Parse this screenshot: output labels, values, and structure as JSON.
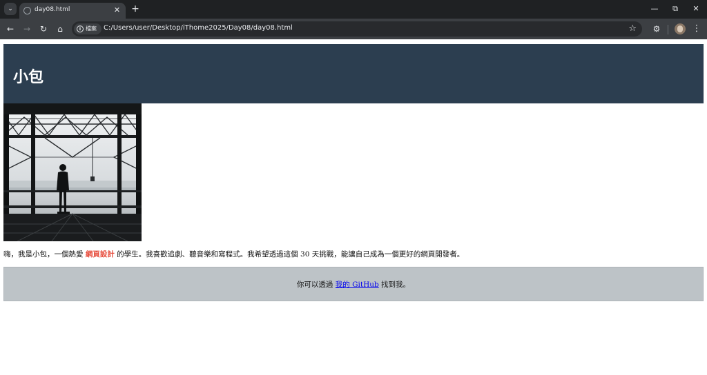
{
  "browser": {
    "tab": {
      "title": "day08.html"
    },
    "omnibox": {
      "site_chip_label": "檔案",
      "url": "C:/Users/user/Desktop/iThome2025/Day08/day08.html"
    }
  },
  "page": {
    "header": {
      "title": "小包"
    },
    "intro": {
      "before": "嗨，我是小包，一個熱愛 ",
      "highlight": "網頁設計",
      "after": " 的學生。我喜歡追劇、聽音樂和寫程式。我希望透過這個 30 天挑戰，能讓自己成為一個更好的網頁開發者。"
    },
    "footer": {
      "before": "你可以透過 ",
      "link_text": "我的 GitHub",
      "after": " 找到我。"
    }
  },
  "colors": {
    "header_bg": "#2c3e50",
    "highlight": "#e74c3c",
    "footer_bg": "#bdc3c7",
    "link": "#0000ee"
  }
}
